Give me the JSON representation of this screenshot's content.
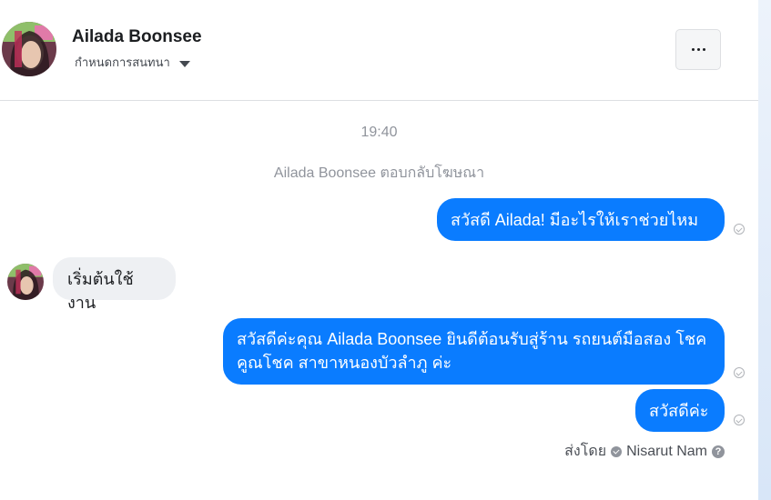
{
  "header": {
    "contact_name": "Ailada Boonsee",
    "assign_label": "กำหนดการสนทนา",
    "more_label": "···"
  },
  "thread": {
    "timestamp": "19:40",
    "system_note": "Ailada Boonsee ตอบกลับโฆษณา",
    "messages": [
      {
        "direction": "outgoing",
        "text": "สวัสดี Ailada! มีอะไรให้เราช่วยไหม"
      },
      {
        "direction": "incoming",
        "text": "เริ่มต้นใช้งาน"
      },
      {
        "direction": "outgoing",
        "text": "สวัสดีค่ะคุณ Ailada Boonsee ยินดีต้อนรับสู่ร้าน รถยนต์มือสอง โชคคูณโชค สาขาหนองบัวลำภู ค่ะ"
      },
      {
        "direction": "outgoing",
        "text": "สวัสดีค่ะ"
      }
    ],
    "sent_by_label": "ส่งโดย",
    "sender_name": "Nisarut Nam",
    "help_glyph": "?"
  },
  "colors": {
    "outgoing_bubble": "#0a7cff",
    "incoming_bubble": "#eef0f3",
    "muted_text": "#90949c"
  }
}
